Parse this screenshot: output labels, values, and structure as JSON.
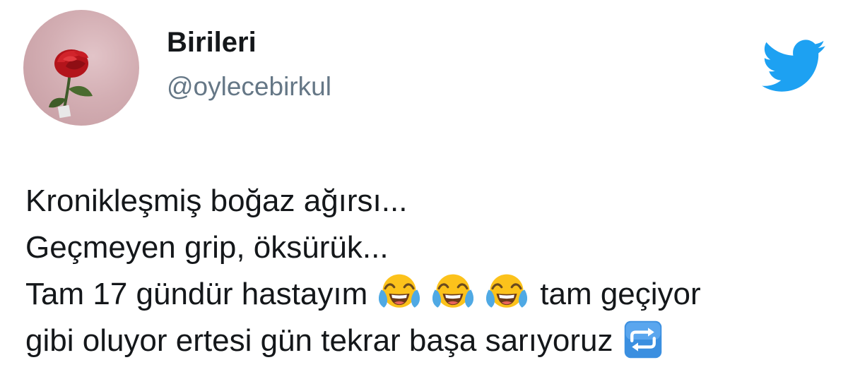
{
  "user": {
    "display_name": "Birileri",
    "handle": "@oylecebirkul"
  },
  "tweet": {
    "line1": "Kronikleşmiş boğaz ağırsı...",
    "line2": "Geçmeyen grip, öksürük...",
    "line3_before": "Tam 17 gündür hastayım",
    "line3_after": "tam geçiyor",
    "line4_before": "gibi oluyor ertesi gün tekrar başa sarıyoruz"
  },
  "icons": {
    "brand": "twitter-bird-icon",
    "emoji_laugh": "face-with-tears-of-joy-emoji",
    "emoji_repeat": "repeat-button-emoji"
  },
  "colors": {
    "twitter_blue": "#1da1f2",
    "handle_gray": "#657786",
    "text": "#14171a",
    "emoji_yellow": "#fcc21b",
    "emoji_tear": "#4fa9e4",
    "repeat_blue": "#3b8fe0"
  }
}
